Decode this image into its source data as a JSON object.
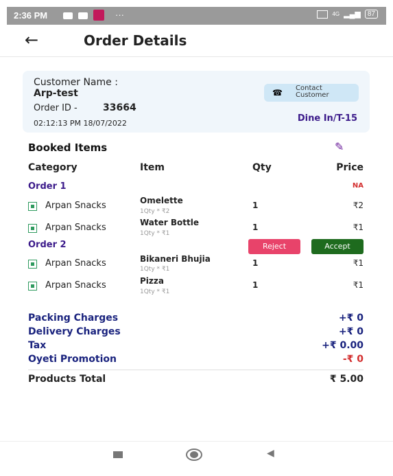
{
  "status": {
    "time": "2:36 PM",
    "dots": "···",
    "battery": "87",
    "signal": "4G"
  },
  "header": {
    "title": "Order Details"
  },
  "customer": {
    "name_label": "Customer Name :",
    "name": "Arp-test",
    "order_id_label": "Order ID - ",
    "order_id": "33664",
    "datetime": "02:12:13 PM 18/07/2022",
    "contact_label_1": "Contact",
    "contact_label_2": "Customer",
    "dine": "Dine In/T-15"
  },
  "booked": {
    "title": "Booked Items"
  },
  "columns": {
    "category": "Category",
    "item": "Item",
    "qty": "Qty",
    "price": "Price"
  },
  "orders": [
    {
      "label": "Order 1",
      "status": "NA",
      "items": [
        {
          "category": "Arpan Snacks",
          "name": "Omelette",
          "sub": "1Qty * ₹2",
          "qty": "1",
          "price": "₹2"
        },
        {
          "category": "Arpan Snacks",
          "name": "Water Bottle",
          "sub": "1Qty * ₹1",
          "qty": "1",
          "price": "₹1"
        }
      ]
    },
    {
      "label": "Order 2",
      "reject": "Reject",
      "accept": "Accept",
      "items": [
        {
          "category": "Arpan Snacks",
          "name": "Bikaneri Bhujia",
          "sub": "1Qty * ₹1",
          "qty": "1",
          "price": "₹1"
        },
        {
          "category": "Arpan Snacks",
          "name": "Pizza",
          "sub": "1Qty * ₹1",
          "qty": "1",
          "price": "₹1"
        }
      ]
    }
  ],
  "charges": [
    {
      "label": "Packing Charges",
      "value": "+₹ 0"
    },
    {
      "label": "Delivery Charges",
      "value": "+₹ 0"
    },
    {
      "label": "Tax",
      "value": "+₹ 0.00"
    },
    {
      "label": "Oyeti Promotion",
      "value": "-₹ 0"
    }
  ],
  "total": {
    "label": "Products Total",
    "value": "₹ 5.00"
  },
  "colors": {
    "accent": "#3b1a8a",
    "reject": "#e8436a",
    "accept": "#1e6b1e",
    "charges": "#1a237e",
    "promo": "#d32f2f"
  }
}
